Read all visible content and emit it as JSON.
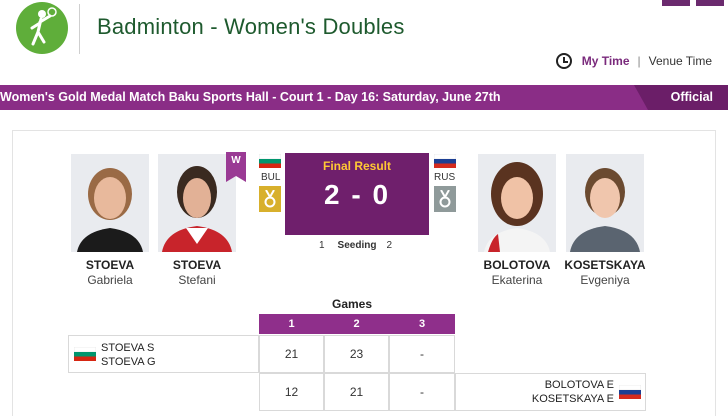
{
  "header": {
    "sport_icon": "badminton-player-icon",
    "title": "Badminton - Women's Doubles",
    "my_time": "My Time",
    "separator": "|",
    "venue_time": "Venue Time"
  },
  "event_bar": {
    "text": "Women's Gold Medal Match  Baku Sports Hall - Court 1 - Day 16: Saturday, June 27th",
    "status": "Official"
  },
  "teams": {
    "left": {
      "noc": "BUL",
      "medal_icon": "gold-medal-icon",
      "winner_badge": "W",
      "players": [
        {
          "last": "STOEVA",
          "first": "Gabriela"
        },
        {
          "last": "STOEVA",
          "first": "Stefani"
        }
      ],
      "seeding": "1"
    },
    "right": {
      "noc": "RUS",
      "medal_icon": "silver-medal-icon",
      "players": [
        {
          "last": "BOLOTOVA",
          "first": "Ekaterina"
        },
        {
          "last": "KOSETSKAYA",
          "first": "Evgeniya"
        }
      ],
      "seeding": "2"
    }
  },
  "result": {
    "label": "Final Result",
    "score": "2 - 0",
    "seeding_label": "Seeding"
  },
  "games": {
    "title": "Games",
    "headers": [
      "1",
      "2",
      "3"
    ],
    "rows": [
      {
        "name1": "STOEVA S",
        "name2": "STOEVA G",
        "scores": [
          "21",
          "23",
          "-"
        ]
      },
      {
        "name1": "BOLOTOVA E",
        "name2": "KOSETSKAYA E",
        "scores": [
          "12",
          "21",
          "-"
        ]
      }
    ]
  },
  "colors": {
    "brand_purple": "#8a2d86",
    "dark_purple": "#6f1f6c",
    "title_green": "#1e5a2e",
    "logo_green": "#5fae3a",
    "gold": "#ffc934"
  }
}
